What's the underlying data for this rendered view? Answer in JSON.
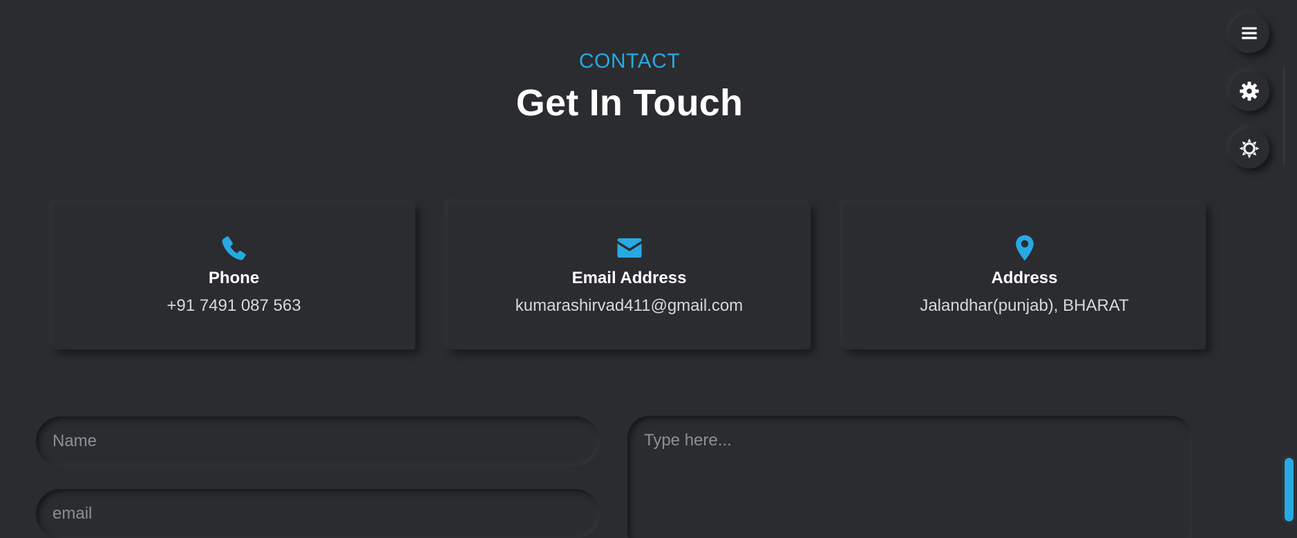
{
  "section": {
    "kicker": "CONTACT",
    "title": "Get In Touch"
  },
  "cards": [
    {
      "icon": "phone-icon",
      "title": "Phone",
      "value": "+91 7491 087 563"
    },
    {
      "icon": "envelope-icon",
      "title": "Email Address",
      "value": "kumarashirvad411@gmail.com"
    },
    {
      "icon": "map-marker-icon",
      "title": "Address",
      "value": "Jalandhar(punjab), BHARAT"
    }
  ],
  "form": {
    "name_placeholder": "Name",
    "email_placeholder": "email",
    "message_placeholder": "Type here..."
  },
  "side_buttons": [
    {
      "icon": "menu-icon"
    },
    {
      "icon": "gear-icon"
    },
    {
      "icon": "sun-icon"
    }
  ],
  "colors": {
    "background": "#2b2c30",
    "accent": "#27a9e3",
    "text": "#ffffff",
    "muted_text": "#d9d9d9"
  }
}
